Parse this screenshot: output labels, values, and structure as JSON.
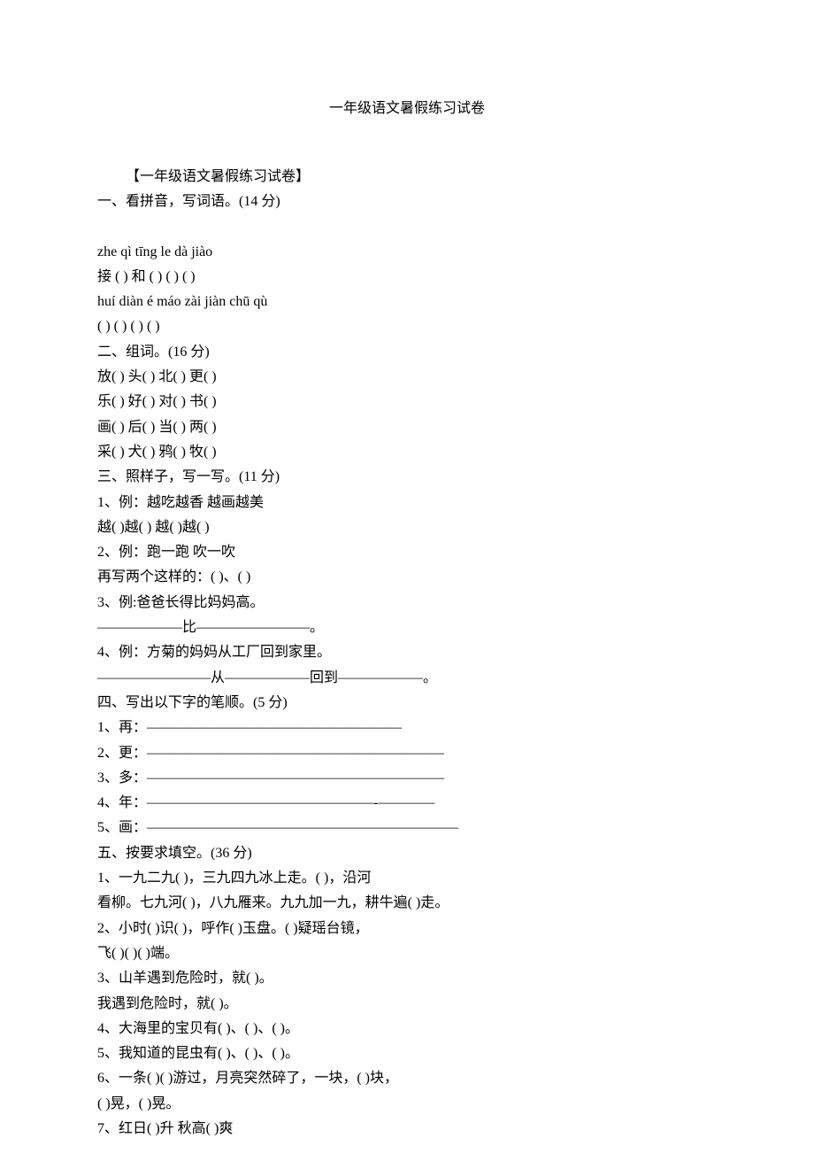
{
  "title": "一年级语文暑假练习试卷",
  "lines": [
    {
      "text": "【一年级语文暑假练习试卷】",
      "indent": true
    },
    {
      "text": "一、看拼音，写词语。(14 分)"
    },
    {
      "gap": true
    },
    {
      "text": "zhe qì tīng le dà jiào"
    },
    {
      "text": "接 ( )  和 ( ) ( ) ( )"
    },
    {
      "text": "huí diàn é máo zài jiàn chū qù"
    },
    {
      "text": "( ) ( ) ( ) ( )"
    },
    {
      "text": "二、组词。(16 分)"
    },
    {
      "text": "放( )  头( )  北( )  更( )"
    },
    {
      "text": "乐( )  好( )  对( )  书( )"
    },
    {
      "text": "画( )  后( )  当( )  两( )"
    },
    {
      "text": "采( )  犬( )  鸦( )  牧( )"
    },
    {
      "text": "三、照样子，写一写。(11 分)"
    },
    {
      "text": "1、例：越吃越香  越画越美"
    },
    {
      "text": "越( )越( )  越( )越( )"
    },
    {
      "text": "2、例：跑一跑  吹一吹"
    },
    {
      "text": "再写两个这样的：( )、( )"
    },
    {
      "text": "3、例:爸爸长得比妈妈高。"
    },
    {
      "text": "——————比————————。"
    },
    {
      "text": "4、例：方菊的妈妈从工厂回到家里。"
    },
    {
      "text": "————————从——————回到——————。"
    },
    {
      "text": "四、写出以下字的笔顺。(5 分)"
    },
    {
      "text": "1、再：——————————————————"
    },
    {
      "text": "2、更：—————————————————————"
    },
    {
      "text": "3、多：—————————————————————"
    },
    {
      "text": "4、年：————————————————-————"
    },
    {
      "text": "5、画：——————————————————————"
    },
    {
      "text": "五、按要求填空。(36 分)"
    },
    {
      "text": "1、一九二九( )，三九四九冰上走。( )，沿河"
    },
    {
      "text": "看柳。七九河( )，八九雁来。九九加一九，耕牛遍( )走。"
    },
    {
      "text": "2、小时( )识( )，呼作( )玉盘。( )疑瑶台镜，"
    },
    {
      "text": "飞( )( )( )端。"
    },
    {
      "text": "3、山羊遇到危险时，就(                                                  )。"
    },
    {
      "text": "我遇到危险时，就(                                             )。"
    },
    {
      "text": "4、大海里的宝贝有( )、( )、( )。"
    },
    {
      "text": "5、我知道的昆虫有( )、( )、( )。"
    },
    {
      "text": "6、一条( )( )游过，月亮突然碎了，一块，( )块，"
    },
    {
      "text": "( )晃，( )晃。"
    },
    {
      "text": "7、红日( )升  秋高( )爽"
    }
  ]
}
